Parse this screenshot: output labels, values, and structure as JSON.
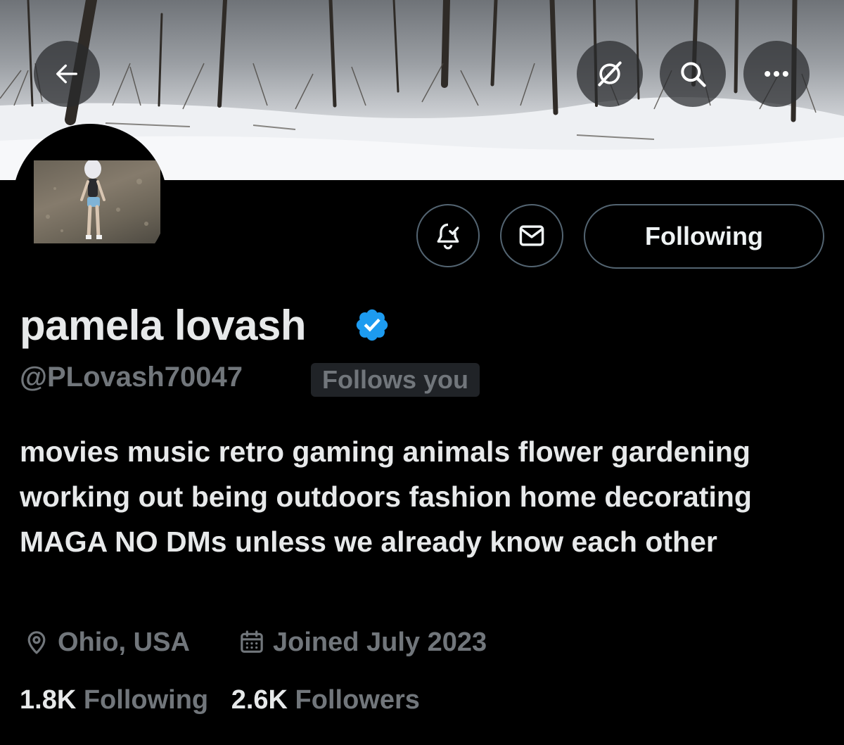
{
  "header": {
    "icons": [
      "back-arrow-icon",
      "grok-icon",
      "search-icon",
      "more-icon"
    ]
  },
  "actions": {
    "notify_icon": "bell-check-icon",
    "message_icon": "envelope-icon",
    "following_label": "Following"
  },
  "profile": {
    "display_name": "pamela lovash",
    "verified_badge": "blue-check-icon",
    "handle": "@PLovash70047",
    "follows_you": "Follows you",
    "bio": "movies music retro gaming animals flower gardening working out being outdoors fashion home decorating MAGA NO DMs unless we already know each other",
    "location": "Ohio, USA",
    "joined": "Joined July 2023"
  },
  "stats": {
    "following_count": "1.8K",
    "following_label": "Following",
    "followers_count": "2.6K",
    "followers_label": "Followers"
  },
  "colors": {
    "background": "#000000",
    "text_primary": "#e7e9ea",
    "text_secondary": "#71767b",
    "border": "#536471",
    "verified": "#1d9bf0"
  }
}
